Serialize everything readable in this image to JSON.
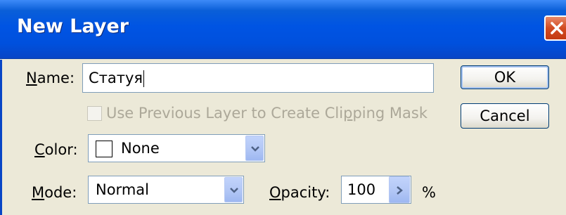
{
  "window": {
    "title": "New Layer"
  },
  "name_field": {
    "label_first": "N",
    "label_rest": "ame:",
    "value": "Статуя"
  },
  "buttons": {
    "ok": "OK",
    "cancel": "Cancel"
  },
  "clipping": {
    "label_a": "Use Previous Layer to Create Cli",
    "label_u": "p",
    "label_b": "ping Mask",
    "checked": false,
    "enabled": false
  },
  "color_field": {
    "label_first": "C",
    "label_rest": "olor:",
    "value": "None",
    "swatch": "#ffffff"
  },
  "mode_field": {
    "label_first": "M",
    "label_rest": "ode:",
    "value": "Normal"
  },
  "opacity_field": {
    "label_first": "O",
    "label_rest": "pacity:",
    "value": "100",
    "unit": "%"
  },
  "icons": {
    "close": "close-icon",
    "dropdown": "chevron-down-icon",
    "spin": "chevron-right-icon"
  }
}
